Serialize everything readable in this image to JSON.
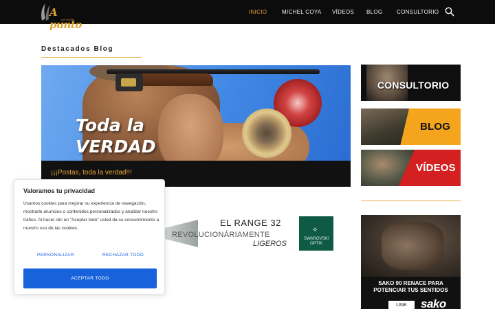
{
  "header": {
    "logo_text": "A punto",
    "logo_tagline": "con Michel Coya",
    "nav": [
      "INICIO",
      "MICHEL COYA",
      "VÍDEOS",
      "BLOG",
      "CONSULTORIO"
    ]
  },
  "section": {
    "title": "Destacados Blog"
  },
  "featured": {
    "headline_line1": "Toda la",
    "headline_line2": "VERDAD",
    "caption": "¡¡¡Postas, toda la verdad!!!"
  },
  "ad": {
    "line1": "EL RANGE 32",
    "line2": "REVOLUCIONÁRIAMENTE",
    "line3": "LIGEROS",
    "brand": "SWAROVSKI OPTIK"
  },
  "sidebar": {
    "tiles": [
      "CONSULTORIO",
      "BLOG",
      "VÍDEOS"
    ],
    "sako": {
      "line1": "SAKO 90 RENACE PARA",
      "line2": "POTENCIAR TUS SENTIDOS",
      "link": "LINK",
      "brand": "sako"
    }
  },
  "cookie": {
    "title": "Valoramos tu privacidad",
    "body": "Usamos cookies para mejorar su experiencia de navegación, mostrarle anuncios o contenidos personalizados y analizar nuestro tráfico. Al hacer clic en “Aceptar todo” usted da su consentimiento a nuestro uso de las cookies.",
    "customize": "PERSONALIZAR",
    "reject": "RECHAZAR TODO",
    "accept": "ACEPTAR TODO"
  },
  "colors": {
    "accent": "#e8a33a",
    "header_bg": "#0c0c0c",
    "cookie_button": "#1863dc"
  }
}
